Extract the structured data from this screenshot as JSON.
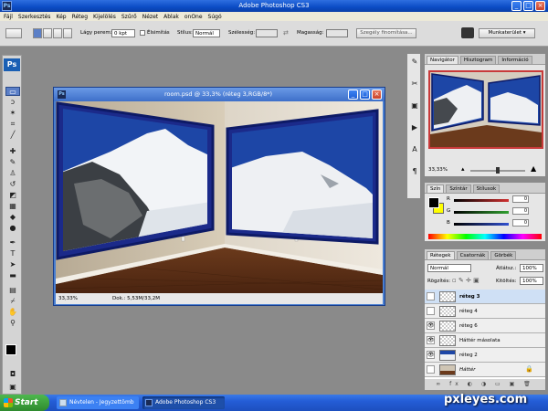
{
  "app": {
    "title": "Adobe Photoshop CS3",
    "badge": "Ps"
  },
  "menu": [
    "Fájl",
    "Szerkesztés",
    "Kép",
    "Réteg",
    "Kijelölés",
    "Szűrő",
    "Nézet",
    "Ablak",
    "onOne",
    "Súgó"
  ],
  "options": {
    "feather_label": "Lágy perem:",
    "feather_value": "0 kpt",
    "antialias_label": "Élsimítás",
    "style_label": "Stílus:",
    "style_value": "Normál",
    "width_label": "Szélesség:",
    "height_label": "Magasság:",
    "refine_button": "Szegély finomítása...",
    "workspace_label": "Munkaterület"
  },
  "document": {
    "title": "room.psd @ 33,3% (réteg 3,RGB/8*)",
    "zoom": "33,33%",
    "doc_info": "Dok.: 5,53M/33,2M"
  },
  "navigator": {
    "tabs": [
      "Navigátor",
      "Hisztogram",
      "Információ"
    ],
    "zoom": "33,33%"
  },
  "color_panel": {
    "tabs": [
      "Szín",
      "Színtár",
      "Stílusok"
    ],
    "channels": [
      {
        "label": "R",
        "value": "0",
        "color": "#d03030"
      },
      {
        "label": "G",
        "value": "0",
        "color": "#30a030"
      },
      {
        "label": "B",
        "value": "0",
        "color": "#3050d0"
      }
    ]
  },
  "layers_panel": {
    "tabs": [
      "Rétegek",
      "Csatornák",
      "Görbék"
    ],
    "blend_mode": "Normál",
    "opacity_label": "Átlátsz.:",
    "opacity_value": "100%",
    "lock_label": "Rögzítés:",
    "fill_label": "Kitöltés:",
    "fill_value": "100%",
    "layers": [
      {
        "name": "réteg 3",
        "visible": false,
        "selected": true
      },
      {
        "name": "réteg 4",
        "visible": false,
        "selected": false
      },
      {
        "name": "réteg 6",
        "visible": true,
        "selected": false
      },
      {
        "name": "Háttér másolata",
        "visible": true,
        "selected": false
      },
      {
        "name": "réteg 2",
        "visible": true,
        "selected": false
      },
      {
        "name": "Háttér",
        "visible": false,
        "selected": false
      }
    ]
  },
  "taskbar": {
    "start": "Start",
    "items": [
      "Névtelen - Jegyzettömb",
      "Adobe Photoshop CS3"
    ]
  },
  "watermark": "pxleyes.com"
}
